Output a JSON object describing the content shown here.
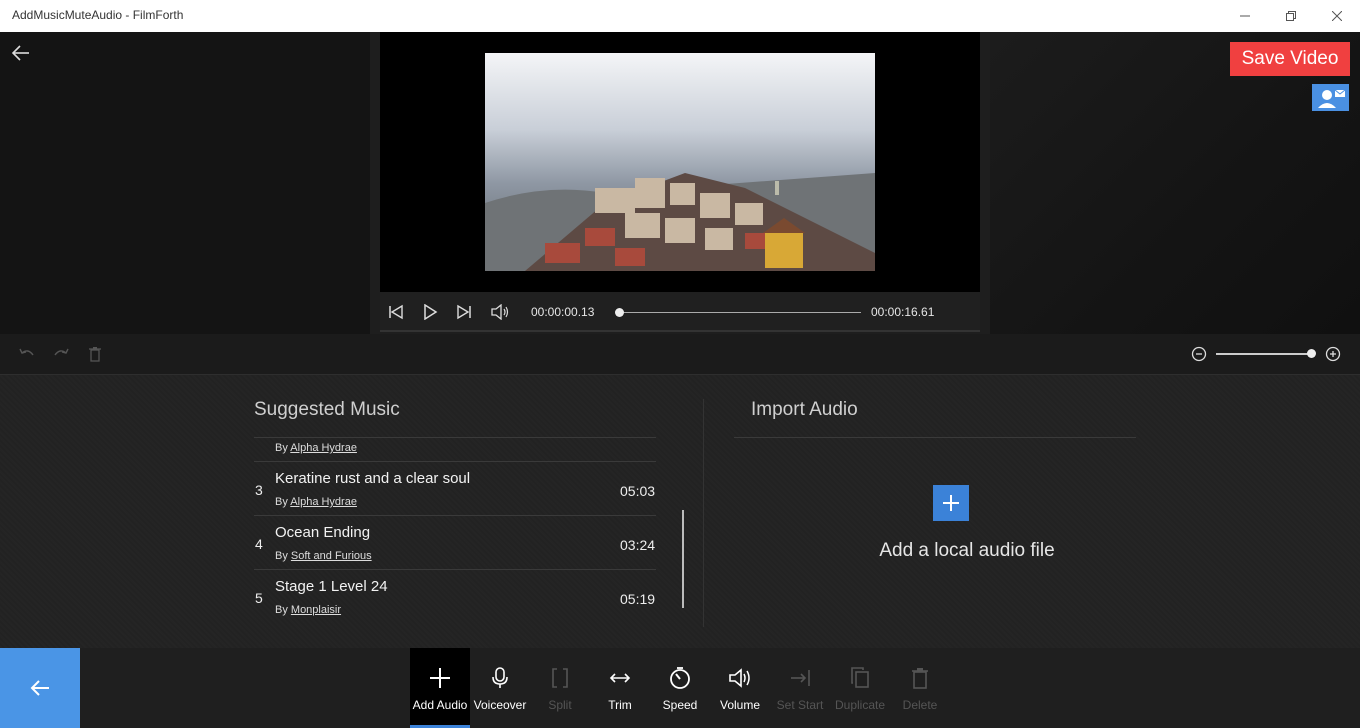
{
  "window": {
    "title": "AddMusicMuteAudio - FilmForth",
    "minimize_glyph": "—",
    "restore_glyph": "❐",
    "close_glyph": "✕"
  },
  "header": {
    "save_label": "Save Video",
    "accent_color": "#f04040"
  },
  "player": {
    "current_time": "00:00:00.13",
    "total_time": "00:00:16.61",
    "progress_fraction": 0.008
  },
  "zoom": {
    "level_fraction": 1.0
  },
  "suggested": {
    "title": "Suggested Music",
    "by_prefix": "By",
    "partial_artist": "Alpha Hydrae",
    "tracks": [
      {
        "num": "3",
        "name": "Keratine rust and a clear soul",
        "artist": "Alpha Hydrae",
        "duration": "05:03"
      },
      {
        "num": "4",
        "name": "Ocean Ending",
        "artist": "Soft and Furious",
        "duration": "03:24"
      },
      {
        "num": "5",
        "name": "Stage 1 Level 24",
        "artist": "Monplaisir",
        "duration": "05:19"
      }
    ]
  },
  "import": {
    "title": "Import Audio",
    "add_label": "Add a local audio file"
  },
  "toolbar": {
    "items": [
      {
        "label": "Add Audio",
        "icon": "plus-icon",
        "state": "active"
      },
      {
        "label": "Voiceover",
        "icon": "microphone-icon",
        "state": "enabled"
      },
      {
        "label": "Split",
        "icon": "split-icon",
        "state": "disabled"
      },
      {
        "label": "Trim",
        "icon": "trim-icon",
        "state": "enabled"
      },
      {
        "label": "Speed",
        "icon": "speed-icon",
        "state": "enabled"
      },
      {
        "label": "Volume",
        "icon": "volume-icon",
        "state": "enabled"
      },
      {
        "label": "Set Start",
        "icon": "set-start-icon",
        "state": "disabled"
      },
      {
        "label": "Duplicate",
        "icon": "duplicate-icon",
        "state": "disabled"
      },
      {
        "label": "Delete",
        "icon": "delete-icon",
        "state": "disabled"
      }
    ]
  }
}
